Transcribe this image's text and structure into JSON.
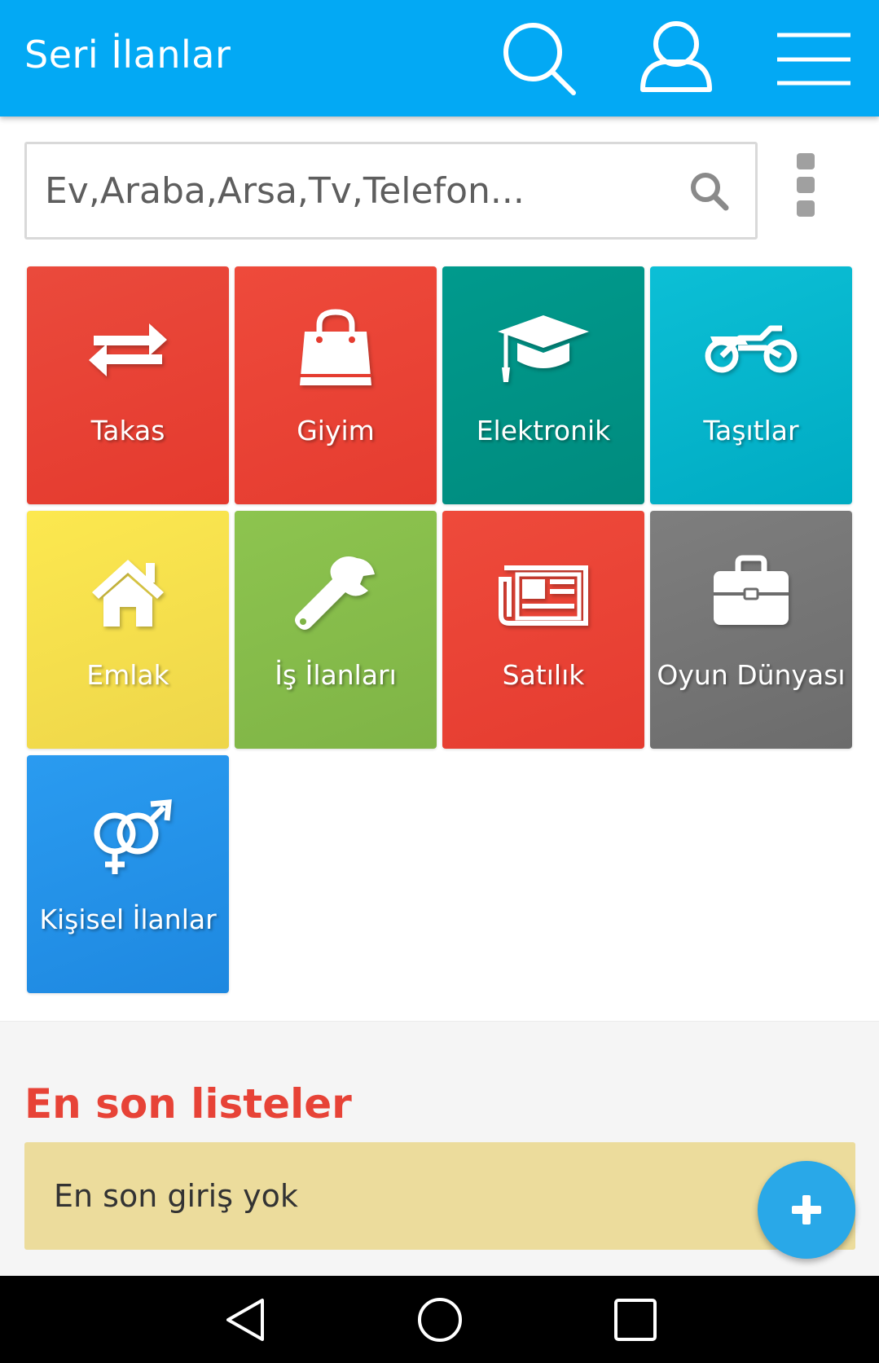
{
  "appbar": {
    "title": "Seri İlanlar",
    "color": "#03a9f4"
  },
  "search": {
    "placeholder": "Ev,Araba,Arsa,Tv,Telefon..."
  },
  "categories": [
    {
      "label": "Takas",
      "icon": "exchange-arrows-icon",
      "color": "#e84133"
    },
    {
      "label": "Giyim",
      "icon": "shopping-bag-icon",
      "color": "#ec4436"
    },
    {
      "label": "Elektronik",
      "icon": "graduation-cap-icon",
      "color": "#00968a"
    },
    {
      "label": "Taşıtlar",
      "icon": "motorcycle-icon",
      "color": "#03b4cc"
    },
    {
      "label": "Emlak",
      "icon": "house-icon",
      "color": "#f5e043"
    },
    {
      "label": "İş İlanları",
      "icon": "wrench-icon",
      "color": "#88c14c"
    },
    {
      "label": "Satılık",
      "icon": "newspaper-icon",
      "color": "#ec4436"
    },
    {
      "label": "Oyun Dünyası",
      "icon": "briefcase-icon",
      "color": "#757575"
    },
    {
      "label": "Kişisel İlanlar",
      "icon": "gender-symbols-icon",
      "color": "#2291e8"
    }
  ],
  "latest": {
    "title": "En son listeler",
    "empty_text": "En son giriş yok"
  }
}
